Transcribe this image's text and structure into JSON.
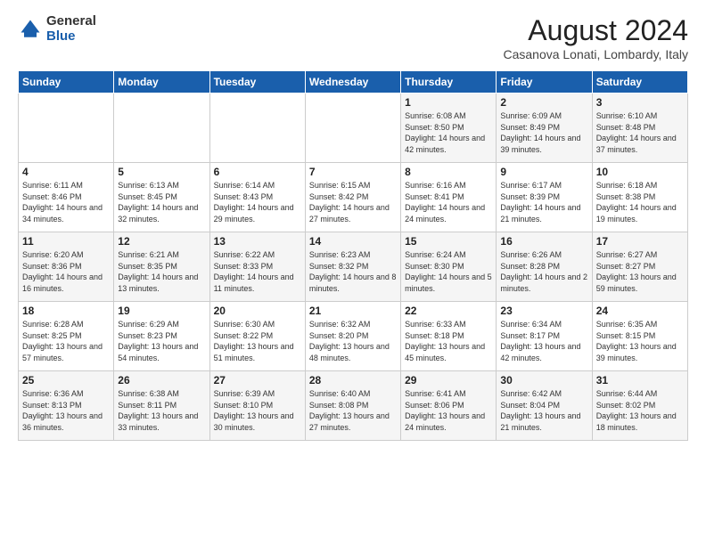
{
  "header": {
    "logo_general": "General",
    "logo_blue": "Blue",
    "month_year": "August 2024",
    "location": "Casanova Lonati, Lombardy, Italy"
  },
  "weekdays": [
    "Sunday",
    "Monday",
    "Tuesday",
    "Wednesday",
    "Thursday",
    "Friday",
    "Saturday"
  ],
  "weeks": [
    [
      {
        "day": "",
        "info": ""
      },
      {
        "day": "",
        "info": ""
      },
      {
        "day": "",
        "info": ""
      },
      {
        "day": "",
        "info": ""
      },
      {
        "day": "1",
        "info": "Sunrise: 6:08 AM\nSunset: 8:50 PM\nDaylight: 14 hours and 42 minutes."
      },
      {
        "day": "2",
        "info": "Sunrise: 6:09 AM\nSunset: 8:49 PM\nDaylight: 14 hours and 39 minutes."
      },
      {
        "day": "3",
        "info": "Sunrise: 6:10 AM\nSunset: 8:48 PM\nDaylight: 14 hours and 37 minutes."
      }
    ],
    [
      {
        "day": "4",
        "info": "Sunrise: 6:11 AM\nSunset: 8:46 PM\nDaylight: 14 hours and 34 minutes."
      },
      {
        "day": "5",
        "info": "Sunrise: 6:13 AM\nSunset: 8:45 PM\nDaylight: 14 hours and 32 minutes."
      },
      {
        "day": "6",
        "info": "Sunrise: 6:14 AM\nSunset: 8:43 PM\nDaylight: 14 hours and 29 minutes."
      },
      {
        "day": "7",
        "info": "Sunrise: 6:15 AM\nSunset: 8:42 PM\nDaylight: 14 hours and 27 minutes."
      },
      {
        "day": "8",
        "info": "Sunrise: 6:16 AM\nSunset: 8:41 PM\nDaylight: 14 hours and 24 minutes."
      },
      {
        "day": "9",
        "info": "Sunrise: 6:17 AM\nSunset: 8:39 PM\nDaylight: 14 hours and 21 minutes."
      },
      {
        "day": "10",
        "info": "Sunrise: 6:18 AM\nSunset: 8:38 PM\nDaylight: 14 hours and 19 minutes."
      }
    ],
    [
      {
        "day": "11",
        "info": "Sunrise: 6:20 AM\nSunset: 8:36 PM\nDaylight: 14 hours and 16 minutes."
      },
      {
        "day": "12",
        "info": "Sunrise: 6:21 AM\nSunset: 8:35 PM\nDaylight: 14 hours and 13 minutes."
      },
      {
        "day": "13",
        "info": "Sunrise: 6:22 AM\nSunset: 8:33 PM\nDaylight: 14 hours and 11 minutes."
      },
      {
        "day": "14",
        "info": "Sunrise: 6:23 AM\nSunset: 8:32 PM\nDaylight: 14 hours and 8 minutes."
      },
      {
        "day": "15",
        "info": "Sunrise: 6:24 AM\nSunset: 8:30 PM\nDaylight: 14 hours and 5 minutes."
      },
      {
        "day": "16",
        "info": "Sunrise: 6:26 AM\nSunset: 8:28 PM\nDaylight: 14 hours and 2 minutes."
      },
      {
        "day": "17",
        "info": "Sunrise: 6:27 AM\nSunset: 8:27 PM\nDaylight: 13 hours and 59 minutes."
      }
    ],
    [
      {
        "day": "18",
        "info": "Sunrise: 6:28 AM\nSunset: 8:25 PM\nDaylight: 13 hours and 57 minutes."
      },
      {
        "day": "19",
        "info": "Sunrise: 6:29 AM\nSunset: 8:23 PM\nDaylight: 13 hours and 54 minutes."
      },
      {
        "day": "20",
        "info": "Sunrise: 6:30 AM\nSunset: 8:22 PM\nDaylight: 13 hours and 51 minutes."
      },
      {
        "day": "21",
        "info": "Sunrise: 6:32 AM\nSunset: 8:20 PM\nDaylight: 13 hours and 48 minutes."
      },
      {
        "day": "22",
        "info": "Sunrise: 6:33 AM\nSunset: 8:18 PM\nDaylight: 13 hours and 45 minutes."
      },
      {
        "day": "23",
        "info": "Sunrise: 6:34 AM\nSunset: 8:17 PM\nDaylight: 13 hours and 42 minutes."
      },
      {
        "day": "24",
        "info": "Sunrise: 6:35 AM\nSunset: 8:15 PM\nDaylight: 13 hours and 39 minutes."
      }
    ],
    [
      {
        "day": "25",
        "info": "Sunrise: 6:36 AM\nSunset: 8:13 PM\nDaylight: 13 hours and 36 minutes."
      },
      {
        "day": "26",
        "info": "Sunrise: 6:38 AM\nSunset: 8:11 PM\nDaylight: 13 hours and 33 minutes."
      },
      {
        "day": "27",
        "info": "Sunrise: 6:39 AM\nSunset: 8:10 PM\nDaylight: 13 hours and 30 minutes."
      },
      {
        "day": "28",
        "info": "Sunrise: 6:40 AM\nSunset: 8:08 PM\nDaylight: 13 hours and 27 minutes."
      },
      {
        "day": "29",
        "info": "Sunrise: 6:41 AM\nSunset: 8:06 PM\nDaylight: 13 hours and 24 minutes."
      },
      {
        "day": "30",
        "info": "Sunrise: 6:42 AM\nSunset: 8:04 PM\nDaylight: 13 hours and 21 minutes."
      },
      {
        "day": "31",
        "info": "Sunrise: 6:44 AM\nSunset: 8:02 PM\nDaylight: 13 hours and 18 minutes."
      }
    ]
  ]
}
